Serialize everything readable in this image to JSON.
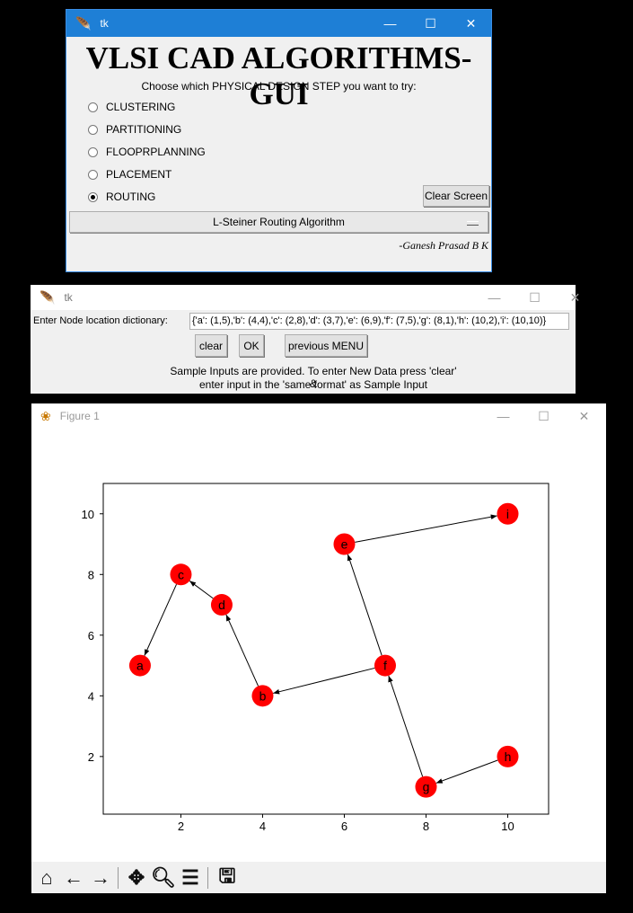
{
  "window1": {
    "title": "tk",
    "heading": "VLSI CAD ALGORITHMS-GUI",
    "prompt": "Choose which PHYSICAL DESIGN STEP you want to try:",
    "options": [
      {
        "label": "CLUSTERING",
        "selected": false
      },
      {
        "label": "PARTITIONING",
        "selected": false
      },
      {
        "label": "FLOOPRPLANNING",
        "selected": false
      },
      {
        "label": "PLACEMENT",
        "selected": false
      },
      {
        "label": "ROUTING",
        "selected": true
      }
    ],
    "clear_screen": "Clear Screen",
    "algorithm_menu": "L-Steiner Routing Algorithm",
    "author": "-Ganesh Prasad B K"
  },
  "window2": {
    "title": "tk",
    "entry_label": "Enter Node location dictionary:",
    "entry_value": "{'a': (1,5),'b': (4,4),'c': (2,8),'d': (3,7),'e': (6,9),'f': (7,5),'g': (8,1),'h': (10,2),'i': (10,10)}",
    "clear": "clear",
    "ok": "OK",
    "previous": "previous MENU",
    "info_line1": "Sample Inputs are provided. To enter New Data press 'clear' &",
    "info_line2": "enter input in the 'same format' as Sample Input"
  },
  "window3": {
    "title": "Figure 1",
    "toolbar": [
      "home-icon",
      "back-icon",
      "forward-icon",
      "pan-icon",
      "zoom-icon",
      "configure-icon",
      "save-icon"
    ]
  },
  "chart_data": {
    "type": "scatter",
    "xlim": [
      0.1,
      11.0
    ],
    "ylim": [
      0.1,
      11.0
    ],
    "xticks": [
      2,
      4,
      6,
      8,
      10
    ],
    "yticks": [
      2,
      4,
      6,
      8,
      10
    ],
    "node_color": "#ff0000",
    "nodes": [
      {
        "name": "a",
        "x": 1,
        "y": 5
      },
      {
        "name": "b",
        "x": 4,
        "y": 4
      },
      {
        "name": "c",
        "x": 2,
        "y": 8
      },
      {
        "name": "d",
        "x": 3,
        "y": 7
      },
      {
        "name": "e",
        "x": 6,
        "y": 9
      },
      {
        "name": "f",
        "x": 7,
        "y": 5
      },
      {
        "name": "g",
        "x": 8,
        "y": 1
      },
      {
        "name": "h",
        "x": 10,
        "y": 2
      },
      {
        "name": "i",
        "x": 10,
        "y": 10
      }
    ],
    "edges": [
      [
        "c",
        "a"
      ],
      [
        "d",
        "c"
      ],
      [
        "b",
        "d"
      ],
      [
        "f",
        "b"
      ],
      [
        "f",
        "e"
      ],
      [
        "e",
        "i"
      ],
      [
        "g",
        "f"
      ],
      [
        "h",
        "g"
      ]
    ]
  }
}
